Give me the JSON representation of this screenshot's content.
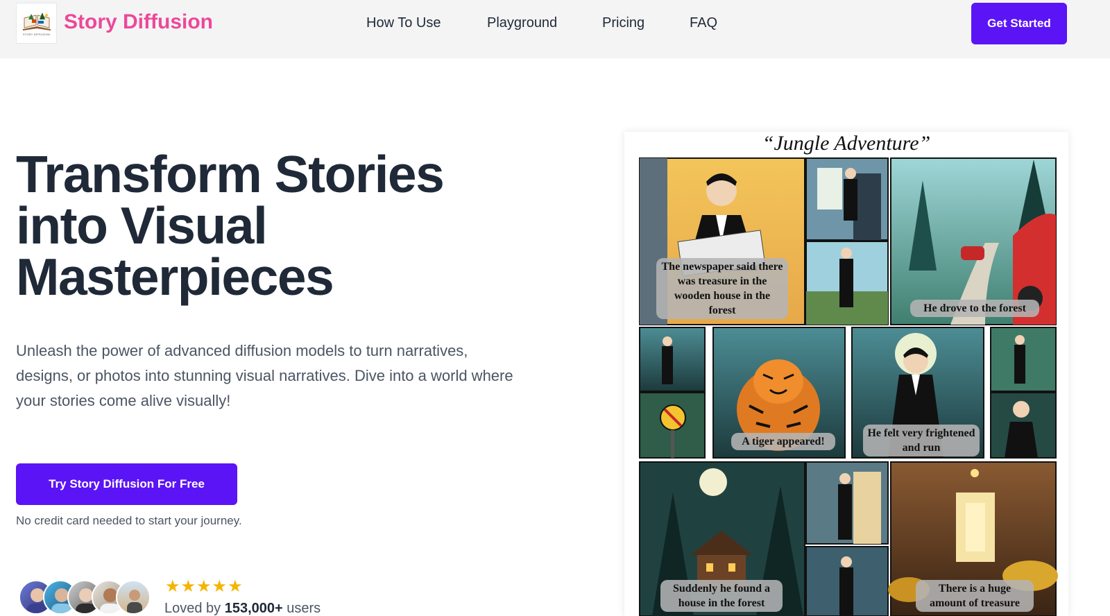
{
  "header": {
    "brand": "Story Diffusion",
    "logo_caption": "STORY DIFFUSION",
    "nav": [
      {
        "label": "How To Use"
      },
      {
        "label": "Playground"
      },
      {
        "label": "Pricing"
      },
      {
        "label": "FAQ"
      }
    ],
    "cta_label": "Get Started"
  },
  "hero": {
    "title_lines": [
      "Transform Stories",
      "into Visual",
      "Masterpieces"
    ],
    "subtitle": "Unleash the power of advanced diffusion models to turn narratives, designs, or photos into stunning visual narratives. Dive into a world where your stories come alive visually!",
    "cta_label": "Try Story Diffusion For Free",
    "note": "No credit card needed to start your journey.",
    "rating_stars": "★★★★★",
    "loved_prefix": "Loved by ",
    "loved_count": "153,000+",
    "loved_suffix": " users"
  },
  "comic": {
    "title": "“Jungle Adventure”",
    "captions": [
      "The newspaper said there was treasure in the wooden house in the forest",
      "He drove to the forest",
      "A tiger appeared!",
      "He felt very frightened and run",
      "Suddenly he found a house in the forest",
      "There is a huge amount of treasure"
    ]
  },
  "colors": {
    "brand_pink": "#ec4899",
    "accent_purple": "#5b14f5",
    "star_gold": "#f5b400"
  }
}
